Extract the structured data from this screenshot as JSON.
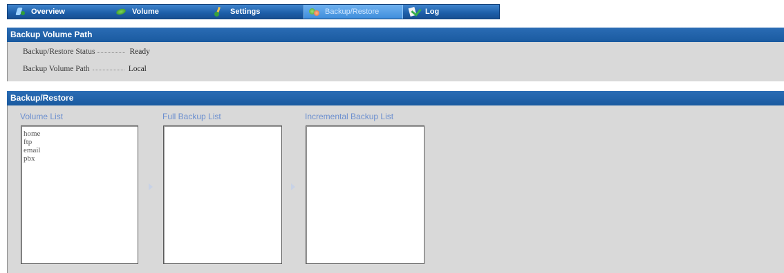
{
  "tabs": [
    {
      "label": "Overview",
      "icon": "overview-icon"
    },
    {
      "label": "Volume",
      "icon": "volume-icon"
    },
    {
      "label": "Settings",
      "icon": "settings-icon"
    },
    {
      "label": "Backup/Restore",
      "icon": "backup-restore-icon",
      "active": true
    },
    {
      "label": "Log",
      "icon": "log-icon"
    }
  ],
  "backup_volume_path": {
    "title": "Backup Volume Path",
    "rows": [
      {
        "label": "Backup/Restore Status",
        "value": "Ready"
      },
      {
        "label": "Backup Volume Path",
        "value": "Local"
      }
    ]
  },
  "backup_restore": {
    "title": "Backup/Restore",
    "volume_list": {
      "label": "Volume List",
      "items": [
        "home",
        "ftp",
        "email",
        "pbx"
      ]
    },
    "full_backup_list": {
      "label": "Full Backup List",
      "items": []
    },
    "incremental_backup_list": {
      "label": "Incremental Backup List",
      "items": []
    }
  },
  "colors": {
    "header_blue": "#1a5aa0",
    "panel_gray": "#d9d9d9",
    "label_blue": "#6c8fcf"
  }
}
